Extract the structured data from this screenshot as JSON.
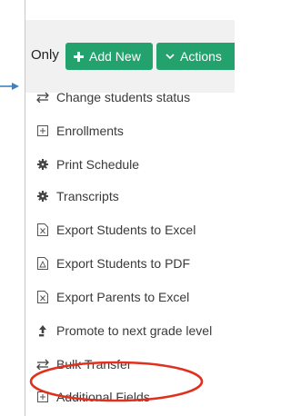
{
  "toolbar": {
    "only_label": "Only",
    "add_new_label": "Add New",
    "actions_label": "Actions"
  },
  "menu": {
    "items": [
      {
        "label": "Change students status",
        "icon": "transfer-arrows-icon"
      },
      {
        "label": "Enrollments",
        "icon": "plus-square-icon"
      },
      {
        "label": "Print Schedule",
        "icon": "gear-icon"
      },
      {
        "label": "Transcripts",
        "icon": "gear-icon"
      },
      {
        "label": "Export Students to Excel",
        "icon": "excel-file-icon"
      },
      {
        "label": "Export Students to PDF",
        "icon": "pdf-file-icon"
      },
      {
        "label": "Export Parents to Excel",
        "icon": "excel-file-icon"
      },
      {
        "label": "Promote to next grade level",
        "icon": "level-up-arrow-icon"
      },
      {
        "label": "Bulk Transfer",
        "icon": "transfer-arrows-icon"
      },
      {
        "label": "Additional Fields",
        "icon": "plus-square-icon"
      }
    ]
  },
  "colors": {
    "button_green": "#23a26d",
    "annotation_red": "#e0301e",
    "pointer_arrow_blue": "#3b82c4"
  }
}
